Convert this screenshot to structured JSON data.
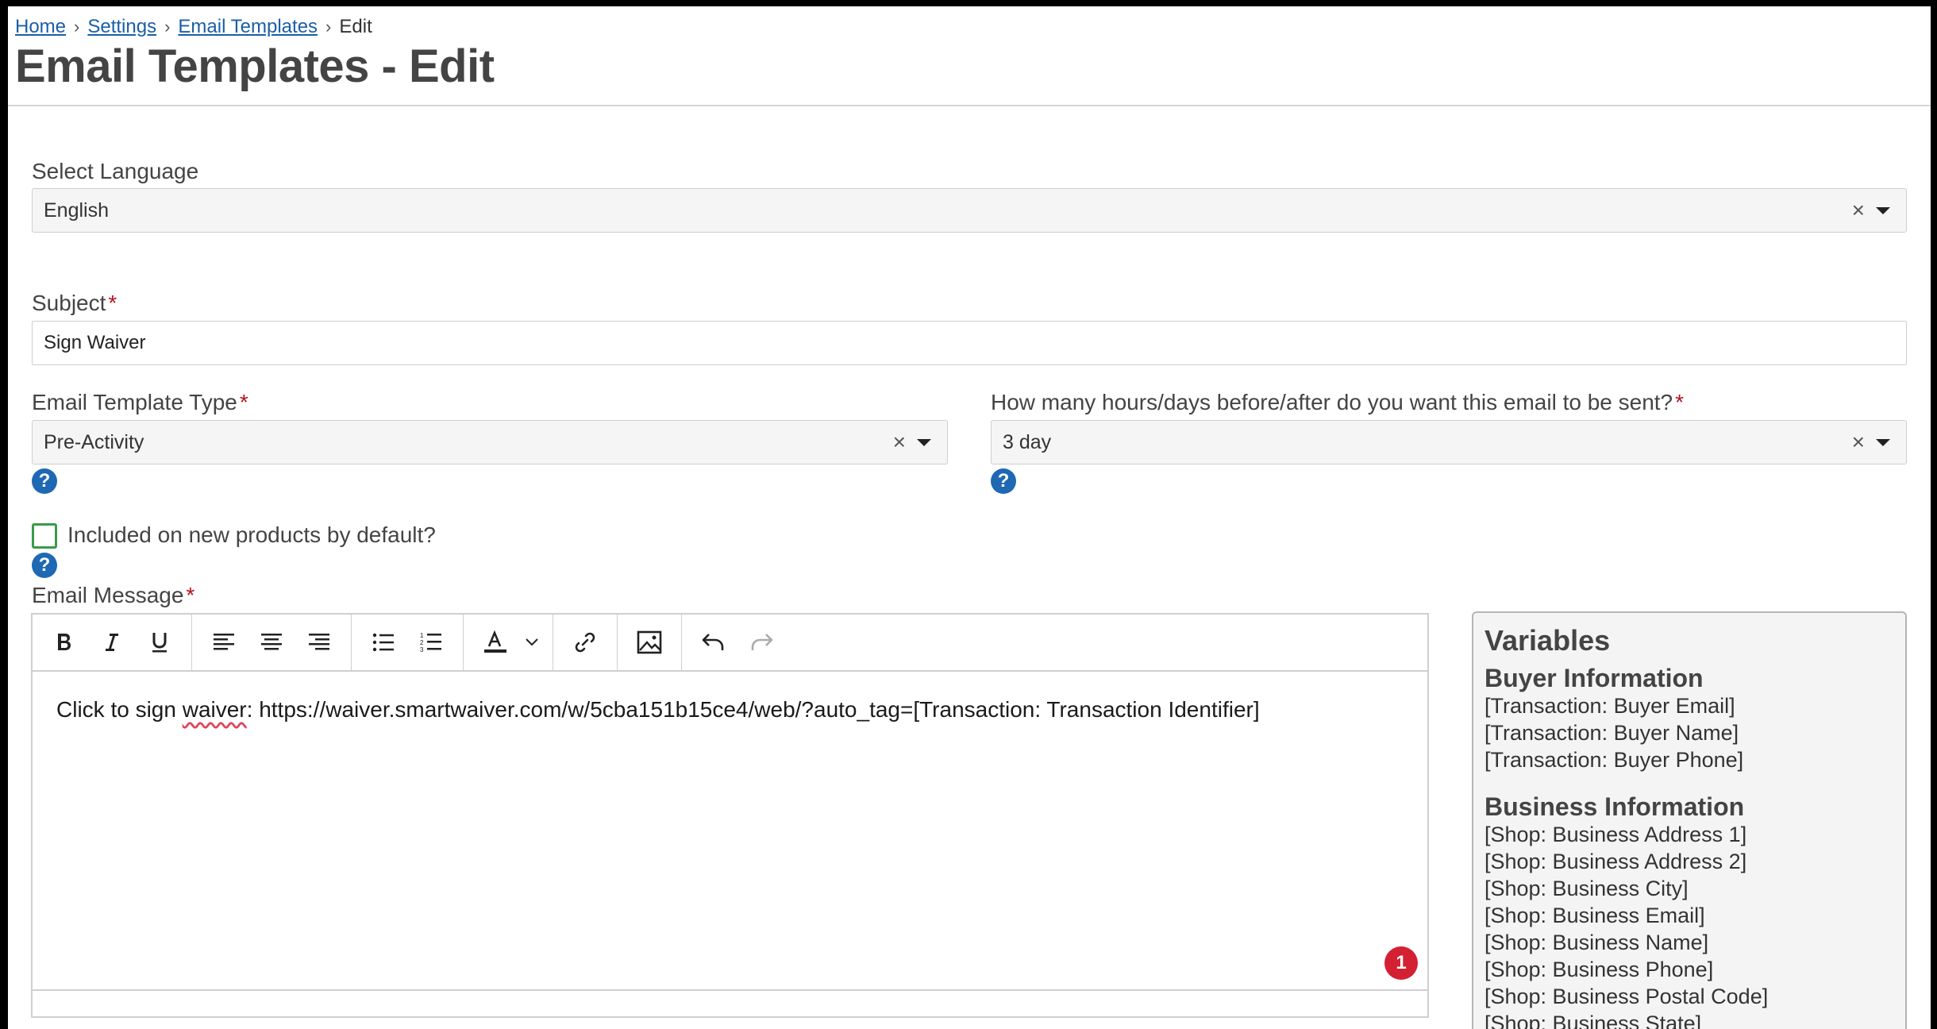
{
  "breadcrumb": {
    "items": [
      "Home",
      "Settings",
      "Email Templates"
    ],
    "current": "Edit"
  },
  "page_title": "Email Templates - Edit",
  "language": {
    "label": "Select Language",
    "value": "English"
  },
  "subject": {
    "label": "Subject",
    "required_mark": "*",
    "value": "Sign Waiver"
  },
  "template_type": {
    "label": "Email Template Type",
    "required_mark": "*",
    "value": "Pre-Activity"
  },
  "timing": {
    "label": "How many hours/days before/after do you want this email to be sent?",
    "required_mark": "*",
    "value": "3 day"
  },
  "default_checkbox": {
    "label": "Included on new products by default?",
    "checked": false
  },
  "message": {
    "label": "Email Message",
    "required_mark": "*",
    "text_before": "Click to sign ",
    "misspelled_word": "waiver",
    "text_after": ": https://waiver.smartwaiver.com/w/5cba151b15ce4/web/?auto_tag=[Transaction: Transaction Identifier]",
    "error_count": "1"
  },
  "icons": {
    "clear": "×",
    "help": "?"
  },
  "variables": {
    "title": "Variables",
    "sections": [
      {
        "heading": "Buyer Information",
        "items": [
          "[Transaction: Buyer Email]",
          "[Transaction: Buyer Name]",
          "[Transaction: Buyer Phone]"
        ]
      },
      {
        "heading": "Business Information",
        "items": [
          "[Shop: Business Address 1]",
          "[Shop: Business Address 2]",
          "[Shop: Business City]",
          "[Shop: Business Email]",
          "[Shop: Business Name]",
          "[Shop: Business Phone]",
          "[Shop: Business Postal Code]",
          "[Shop: Business State]"
        ]
      }
    ]
  },
  "colors": {
    "link": "#1a5fa8",
    "required": "#b3121f",
    "help_icon": "#1e68b4",
    "checkbox_border": "#3a9a4a",
    "error_badge": "#d32033"
  }
}
